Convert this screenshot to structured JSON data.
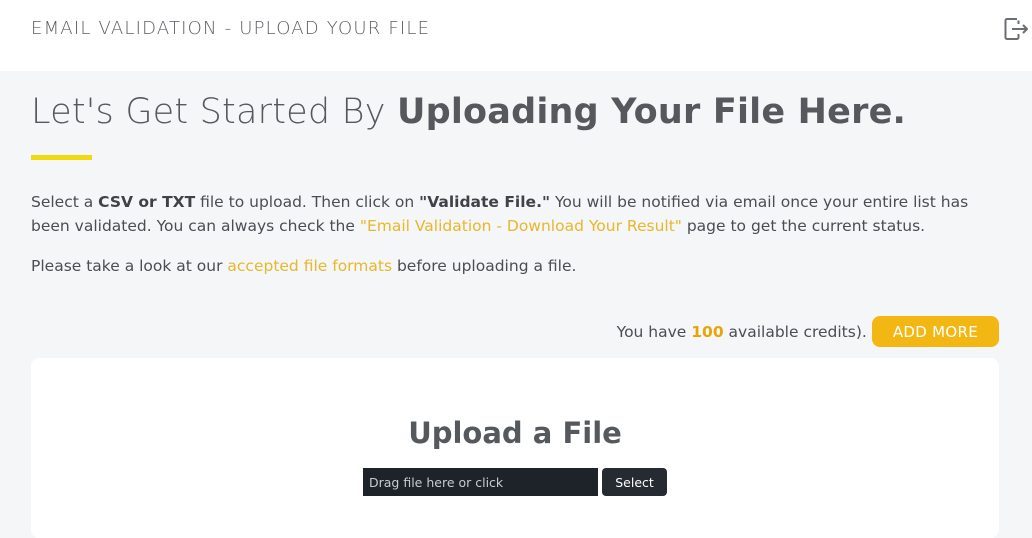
{
  "header": {
    "title": "EMAIL VALIDATION - UPLOAD YOUR FILE",
    "logout_icon": "logout-icon"
  },
  "heading": {
    "light": "Let's Get Started By ",
    "bold": "Uploading Your File Here."
  },
  "intro": {
    "t1": "Select a ",
    "b1": "CSV or TXT",
    "t2": " file to upload. Then click on ",
    "b2": "\"Validate File.\"",
    "t3": " You will be notified via email once your entire list has been validated. You can always check the ",
    "link": "\"Email Validation - Download Your Result\"",
    "t4": " page to get the current status."
  },
  "formats": {
    "t1": "Please take a look at our ",
    "link": "accepted file formats",
    "t2": " before uploading a file."
  },
  "credits": {
    "prefix": "You have ",
    "count": "100",
    "suffix": " available credits).",
    "button": "ADD MORE"
  },
  "upload": {
    "title": "Upload a File",
    "placeholder": "Drag file here or click",
    "select_label": "Select"
  },
  "colors": {
    "accent_yellow": "#f0d90e",
    "button_yellow": "#f2b713",
    "link": "#e8b72a"
  }
}
